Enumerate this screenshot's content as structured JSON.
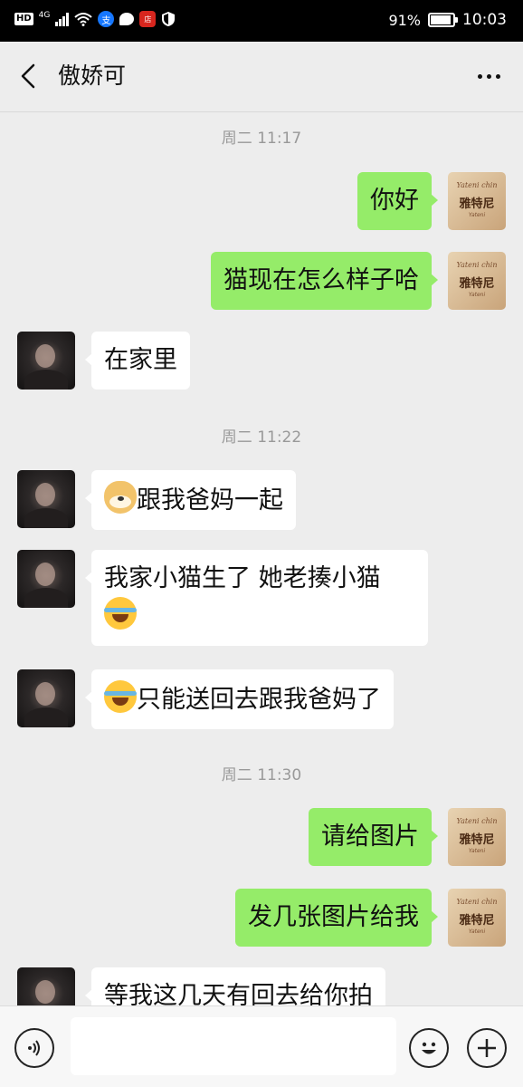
{
  "status_bar": {
    "left_badge": "HD",
    "network": "4G",
    "battery_percent": "91%",
    "clock": "10:03",
    "icons": [
      "signal-icon",
      "wifi-icon",
      "alipay-icon",
      "chat-bubble-icon",
      "shop-icon",
      "shield-icon"
    ]
  },
  "header": {
    "title": "傲娇可",
    "back_icon": "chevron-left-icon",
    "more_icon": "more-dots-icon"
  },
  "messages": [
    {
      "type": "time",
      "text": "周二 11:17"
    },
    {
      "type": "msg",
      "from": "me",
      "text": "你好"
    },
    {
      "type": "msg",
      "from": "me",
      "text": "猫现在怎么样子哈"
    },
    {
      "type": "msg",
      "from": "them",
      "text": "在家里"
    },
    {
      "type": "time",
      "text": "周二 11:22"
    },
    {
      "type": "msg",
      "from": "them",
      "emoji": "doge-emoji",
      "text": "跟我爸妈一起"
    },
    {
      "type": "msg",
      "from": "them",
      "text": "我家小猫生了 她老揍小猫",
      "emoji_after": "crying-emoji"
    },
    {
      "type": "msg",
      "from": "them",
      "emoji": "crying-emoji",
      "text": "只能送回去跟我爸妈了"
    },
    {
      "type": "time",
      "text": "周二 11:30"
    },
    {
      "type": "msg",
      "from": "me",
      "text": "请给图片"
    },
    {
      "type": "msg",
      "from": "me",
      "text": "发几张图片给我"
    },
    {
      "type": "msg",
      "from": "them",
      "text": "等我这几天有回去给你拍"
    }
  ],
  "my_avatar": {
    "brand_top": "Yateni chin",
    "brand_main": "雅特尼",
    "brand_sub": "Yateni"
  },
  "input_bar": {
    "voice_icon": "voice-icon",
    "emoji_icon": "emoji-face-icon",
    "plus_icon": "plus-icon",
    "text": ""
  },
  "colors": {
    "my_bubble": "#95ec69",
    "their_bubble": "#ffffff",
    "background": "#ededed"
  }
}
